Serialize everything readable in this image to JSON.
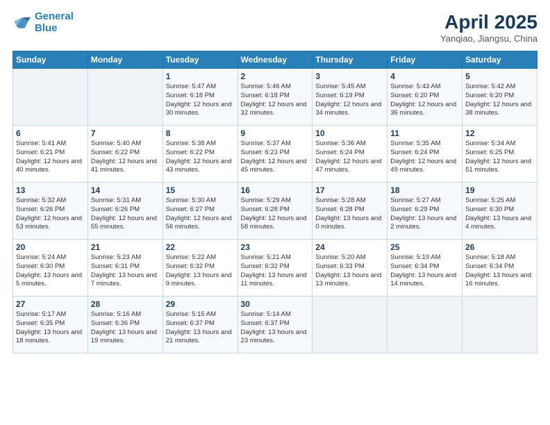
{
  "header": {
    "logo_line1": "General",
    "logo_line2": "Blue",
    "title": "April 2025",
    "subtitle": "Yanqiao, Jiangsu, China"
  },
  "weekdays": [
    "Sunday",
    "Monday",
    "Tuesday",
    "Wednesday",
    "Thursday",
    "Friday",
    "Saturday"
  ],
  "weeks": [
    [
      {
        "day": "",
        "info": ""
      },
      {
        "day": "",
        "info": ""
      },
      {
        "day": "1",
        "info": "Sunrise: 5:47 AM\nSunset: 6:18 PM\nDaylight: 12 hours and 30 minutes."
      },
      {
        "day": "2",
        "info": "Sunrise: 5:46 AM\nSunset: 6:18 PM\nDaylight: 12 hours and 32 minutes."
      },
      {
        "day": "3",
        "info": "Sunrise: 5:45 AM\nSunset: 6:19 PM\nDaylight: 12 hours and 34 minutes."
      },
      {
        "day": "4",
        "info": "Sunrise: 5:43 AM\nSunset: 6:20 PM\nDaylight: 12 hours and 36 minutes."
      },
      {
        "day": "5",
        "info": "Sunrise: 5:42 AM\nSunset: 6:20 PM\nDaylight: 12 hours and 38 minutes."
      }
    ],
    [
      {
        "day": "6",
        "info": "Sunrise: 5:41 AM\nSunset: 6:21 PM\nDaylight: 12 hours and 40 minutes."
      },
      {
        "day": "7",
        "info": "Sunrise: 5:40 AM\nSunset: 6:22 PM\nDaylight: 12 hours and 41 minutes."
      },
      {
        "day": "8",
        "info": "Sunrise: 5:38 AM\nSunset: 6:22 PM\nDaylight: 12 hours and 43 minutes."
      },
      {
        "day": "9",
        "info": "Sunrise: 5:37 AM\nSunset: 6:23 PM\nDaylight: 12 hours and 45 minutes."
      },
      {
        "day": "10",
        "info": "Sunrise: 5:36 AM\nSunset: 6:24 PM\nDaylight: 12 hours and 47 minutes."
      },
      {
        "day": "11",
        "info": "Sunrise: 5:35 AM\nSunset: 6:24 PM\nDaylight: 12 hours and 49 minutes."
      },
      {
        "day": "12",
        "info": "Sunrise: 5:34 AM\nSunset: 6:25 PM\nDaylight: 12 hours and 51 minutes."
      }
    ],
    [
      {
        "day": "13",
        "info": "Sunrise: 5:32 AM\nSunset: 6:26 PM\nDaylight: 12 hours and 53 minutes."
      },
      {
        "day": "14",
        "info": "Sunrise: 5:31 AM\nSunset: 6:26 PM\nDaylight: 12 hours and 55 minutes."
      },
      {
        "day": "15",
        "info": "Sunrise: 5:30 AM\nSunset: 6:27 PM\nDaylight: 12 hours and 56 minutes."
      },
      {
        "day": "16",
        "info": "Sunrise: 5:29 AM\nSunset: 6:28 PM\nDaylight: 12 hours and 58 minutes."
      },
      {
        "day": "17",
        "info": "Sunrise: 5:28 AM\nSunset: 6:28 PM\nDaylight: 13 hours and 0 minutes."
      },
      {
        "day": "18",
        "info": "Sunrise: 5:27 AM\nSunset: 6:29 PM\nDaylight: 13 hours and 2 minutes."
      },
      {
        "day": "19",
        "info": "Sunrise: 5:25 AM\nSunset: 6:30 PM\nDaylight: 13 hours and 4 minutes."
      }
    ],
    [
      {
        "day": "20",
        "info": "Sunrise: 5:24 AM\nSunset: 6:30 PM\nDaylight: 13 hours and 5 minutes."
      },
      {
        "day": "21",
        "info": "Sunrise: 5:23 AM\nSunset: 6:31 PM\nDaylight: 13 hours and 7 minutes."
      },
      {
        "day": "22",
        "info": "Sunrise: 5:22 AM\nSunset: 6:32 PM\nDaylight: 13 hours and 9 minutes."
      },
      {
        "day": "23",
        "info": "Sunrise: 5:21 AM\nSunset: 6:32 PM\nDaylight: 13 hours and 11 minutes."
      },
      {
        "day": "24",
        "info": "Sunrise: 5:20 AM\nSunset: 6:33 PM\nDaylight: 13 hours and 13 minutes."
      },
      {
        "day": "25",
        "info": "Sunrise: 5:19 AM\nSunset: 6:34 PM\nDaylight: 13 hours and 14 minutes."
      },
      {
        "day": "26",
        "info": "Sunrise: 5:18 AM\nSunset: 6:34 PM\nDaylight: 13 hours and 16 minutes."
      }
    ],
    [
      {
        "day": "27",
        "info": "Sunrise: 5:17 AM\nSunset: 6:35 PM\nDaylight: 13 hours and 18 minutes."
      },
      {
        "day": "28",
        "info": "Sunrise: 5:16 AM\nSunset: 6:36 PM\nDaylight: 13 hours and 19 minutes."
      },
      {
        "day": "29",
        "info": "Sunrise: 5:15 AM\nSunset: 6:37 PM\nDaylight: 13 hours and 21 minutes."
      },
      {
        "day": "30",
        "info": "Sunrise: 5:14 AM\nSunset: 6:37 PM\nDaylight: 13 hours and 23 minutes."
      },
      {
        "day": "",
        "info": ""
      },
      {
        "day": "",
        "info": ""
      },
      {
        "day": "",
        "info": ""
      }
    ]
  ]
}
